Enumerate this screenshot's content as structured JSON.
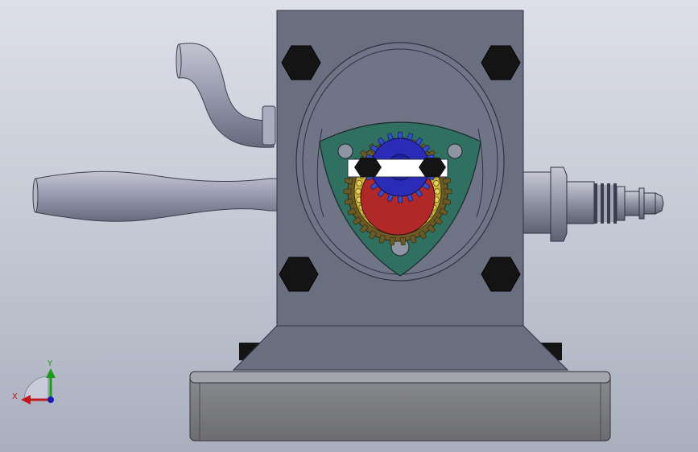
{
  "viewport": {
    "view": "Front",
    "background_top": "#dde0e9",
    "background_bottom": "#a9afbd"
  },
  "model": {
    "parts": [
      "base-plate",
      "base-pedestal",
      "engine-housing",
      "rotor-chamber",
      "rotor",
      "eccentric-shaft-gear",
      "ring-gear",
      "intake-pipe",
      "exhaust-pipe",
      "spark-plug",
      "hex-bolt"
    ],
    "colors": {
      "housing": "#6a6f80",
      "rotor": "#2f7060",
      "ring_gear": "#c9b53a",
      "eccentric": "#b02828",
      "sun_gear": "#2a2cb8",
      "pipe": "#9598aa",
      "spark_plug": "#8e92a3",
      "bolt": "#141414",
      "base": "#7b7c80"
    }
  },
  "triad": {
    "x_label": "X",
    "y_label": "Y",
    "x_color": "#c21a1a",
    "y_color": "#1a9b1a",
    "z_color": "#1a1ab8"
  }
}
